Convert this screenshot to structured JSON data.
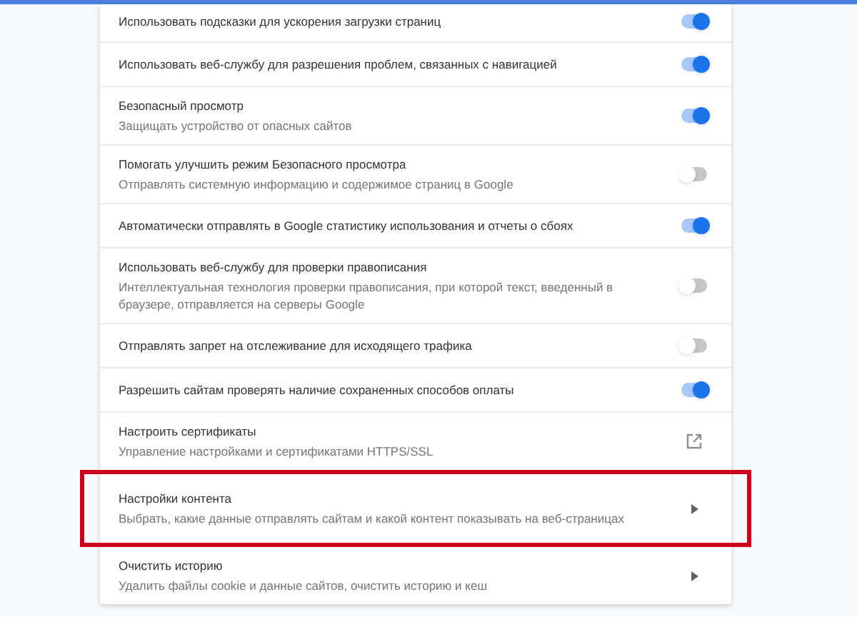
{
  "settings": [
    {
      "kind": "toggle",
      "title": "Использовать подсказки для ускорения загрузки страниц",
      "on": true,
      "highlighted": false
    },
    {
      "kind": "toggle",
      "title": "Использовать веб-службу для разрешения проблем, связанных с навигацией",
      "on": true,
      "highlighted": false
    },
    {
      "kind": "toggle",
      "title": "Безопасный просмотр",
      "subtitle": "Защищать устройство от опасных сайтов",
      "on": true,
      "highlighted": false
    },
    {
      "kind": "toggle",
      "title": "Помогать улучшить режим Безопасного просмотра",
      "subtitle": "Отправлять системную информацию и содержимое страниц в Google",
      "on": false,
      "highlighted": false
    },
    {
      "kind": "toggle",
      "title": "Автоматически отправлять в Google статистику использования и отчеты о сбоях",
      "on": true,
      "highlighted": false
    },
    {
      "kind": "toggle",
      "title": "Использовать веб-службу для проверки правописания",
      "subtitle": "Интеллектуальная технология проверки правописания, при которой текст, введенный в браузере, отправляется на серверы Google",
      "on": false,
      "highlighted": false
    },
    {
      "kind": "toggle",
      "title": "Отправлять запрет на отслеживание для исходящего трафика",
      "on": false,
      "highlighted": false
    },
    {
      "kind": "toggle",
      "title": "Разрешить сайтам проверять наличие сохраненных способов оплаты",
      "on": true,
      "highlighted": false
    },
    {
      "kind": "external",
      "title": "Настроить сертификаты",
      "subtitle": "Управление настройками и сертификатами HTTPS/SSL",
      "highlighted": false
    },
    {
      "kind": "arrow",
      "title": "Настройки контента",
      "subtitle": "Выбрать, какие данные отправлять сайтам и какой контент показывать на веб-страницах",
      "highlighted": true
    },
    {
      "kind": "arrow",
      "title": "Очистить историю",
      "subtitle": "Удалить файлы cookie и данные сайтов, очистить историю и кеш",
      "highlighted": false
    }
  ]
}
